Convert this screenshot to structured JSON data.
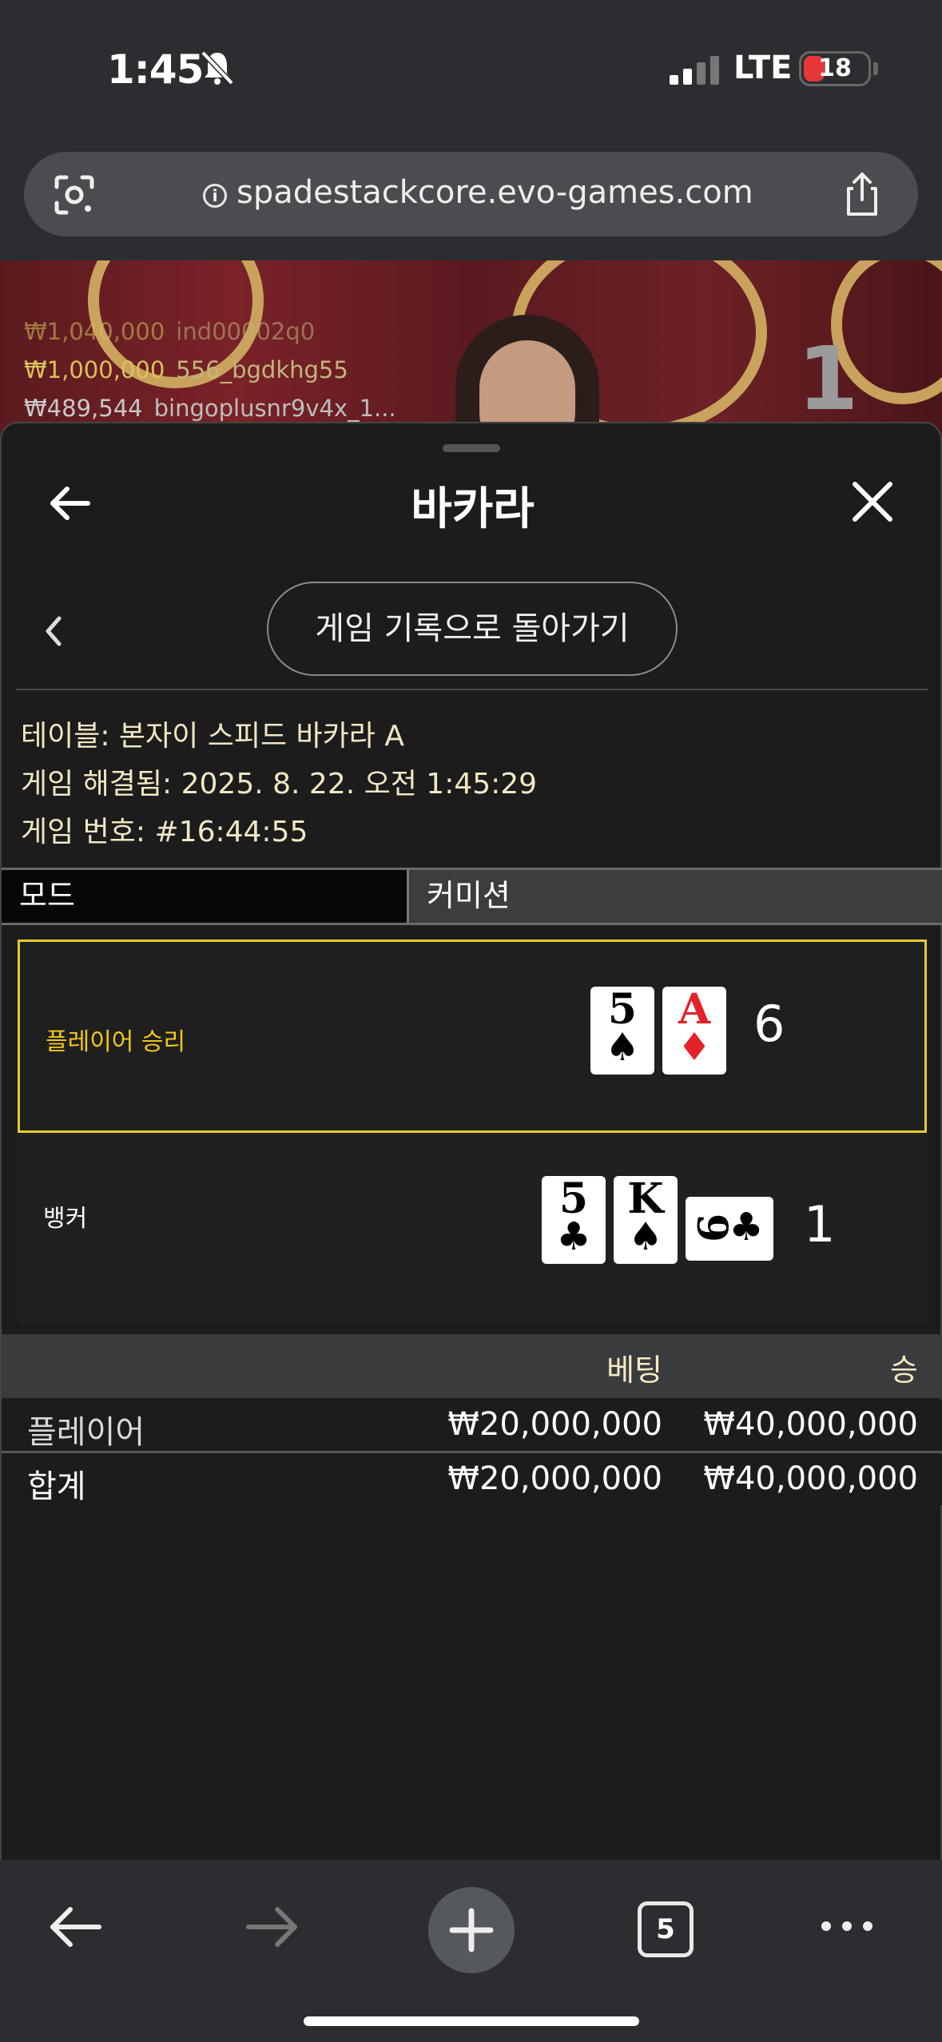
{
  "status": {
    "time": "1:45",
    "network": "LTE",
    "battery": "18"
  },
  "browser": {
    "url": "spadestackcore.evo-games.com",
    "tab_count": "5"
  },
  "video": {
    "winners": [
      {
        "amount": "₩1,040,000",
        "name": "ind00002q0"
      },
      {
        "amount": "₩1,000,000",
        "name": "556_bgdkhg55"
      },
      {
        "amount": "₩489,544",
        "name": "bingoplusnr9v4x_1..."
      }
    ],
    "overlay_number": "1"
  },
  "sheet": {
    "title": "바카라",
    "back_to_history": "게임 기록으로 돌아가기",
    "table": "테이블: 본자이 스피드 바카라 A",
    "resolved": "게임 해결됨: 2025. 8. 22. 오전 1:45:29",
    "game_number": "게임 번호: #16:44:55",
    "mode_label": "모드",
    "mode_value": "커미션"
  },
  "result": {
    "player": {
      "label": "플레이어 승리",
      "cards": [
        {
          "rank": "5",
          "suit": "♠",
          "color": "black"
        },
        {
          "rank": "A",
          "suit": "♦",
          "color": "red"
        }
      ],
      "score": "6"
    },
    "banker": {
      "label": "뱅커",
      "cards": [
        {
          "rank": "5",
          "suit": "♣",
          "color": "black"
        },
        {
          "rank": "K",
          "suit": "♠",
          "color": "black"
        },
        {
          "rank": "9",
          "suit": "♣",
          "color": "black",
          "sideways": true
        }
      ],
      "score": "1"
    }
  },
  "bets": {
    "col_bet": "베팅",
    "col_win": "승",
    "rows": [
      {
        "label": "플레이어",
        "bet": "₩20,000,000",
        "win": "₩40,000,000"
      },
      {
        "label": "합계",
        "bet": "₩20,000,000",
        "win": "₩40,000,000"
      }
    ]
  },
  "colors": {
    "accent_gold": "#e5cc2a",
    "player_label": "#f2c81c",
    "sheet_bg": "#1c1c1d"
  }
}
